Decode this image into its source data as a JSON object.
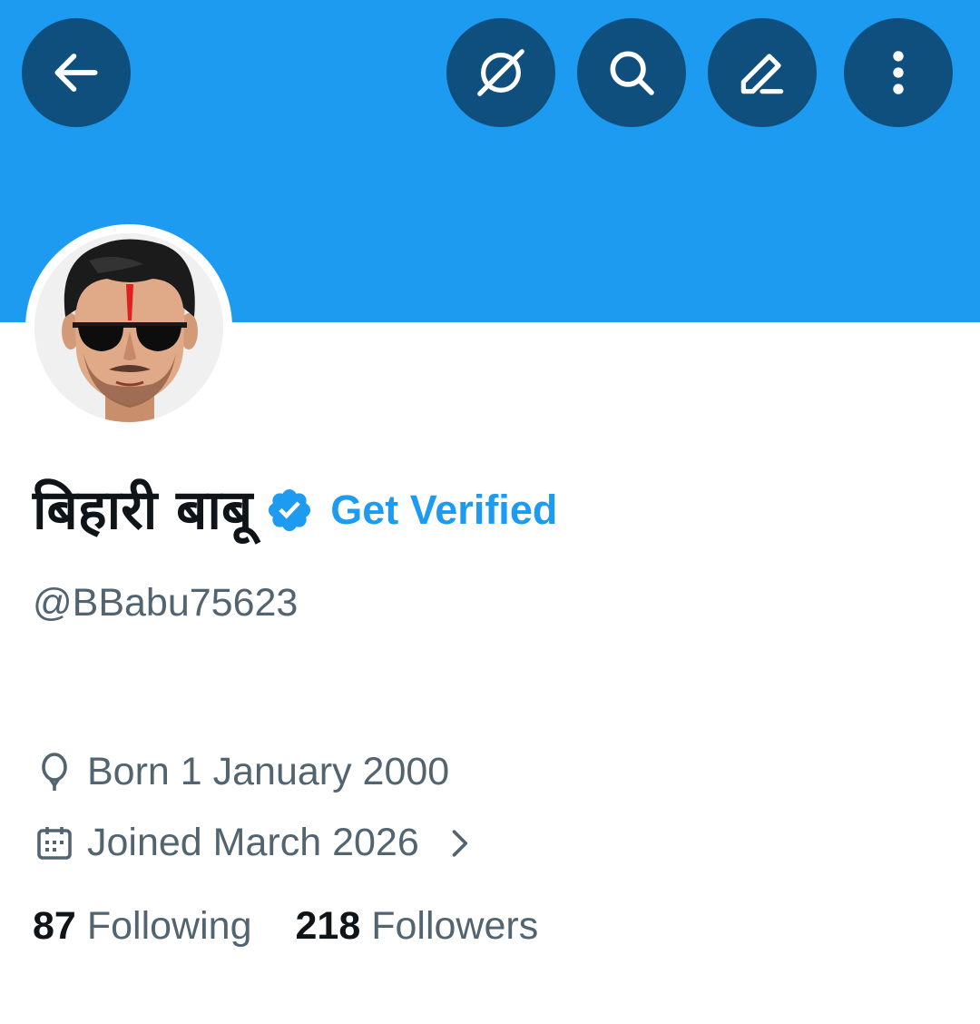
{
  "header": {
    "icons": [
      "back-arrow-icon",
      "grok-icon",
      "search-icon",
      "edit-icon",
      "more-vertical-icon"
    ],
    "banner_color": "#1d9bf0",
    "button_color": "#0f4f7e"
  },
  "profile": {
    "display_name": "बिहारी बाबू",
    "verified": true,
    "get_verified_label": "Get Verified",
    "handle": "@BBabu75623",
    "born": "Born 1 January 2000",
    "joined": "Joined March 2026"
  },
  "stats": {
    "following_count": "87",
    "following_label": "Following",
    "followers_count": "218",
    "followers_label": "Followers"
  },
  "colors": {
    "accent": "#1d9bf0",
    "text_primary": "#0f1419",
    "text_secondary": "#536471"
  }
}
